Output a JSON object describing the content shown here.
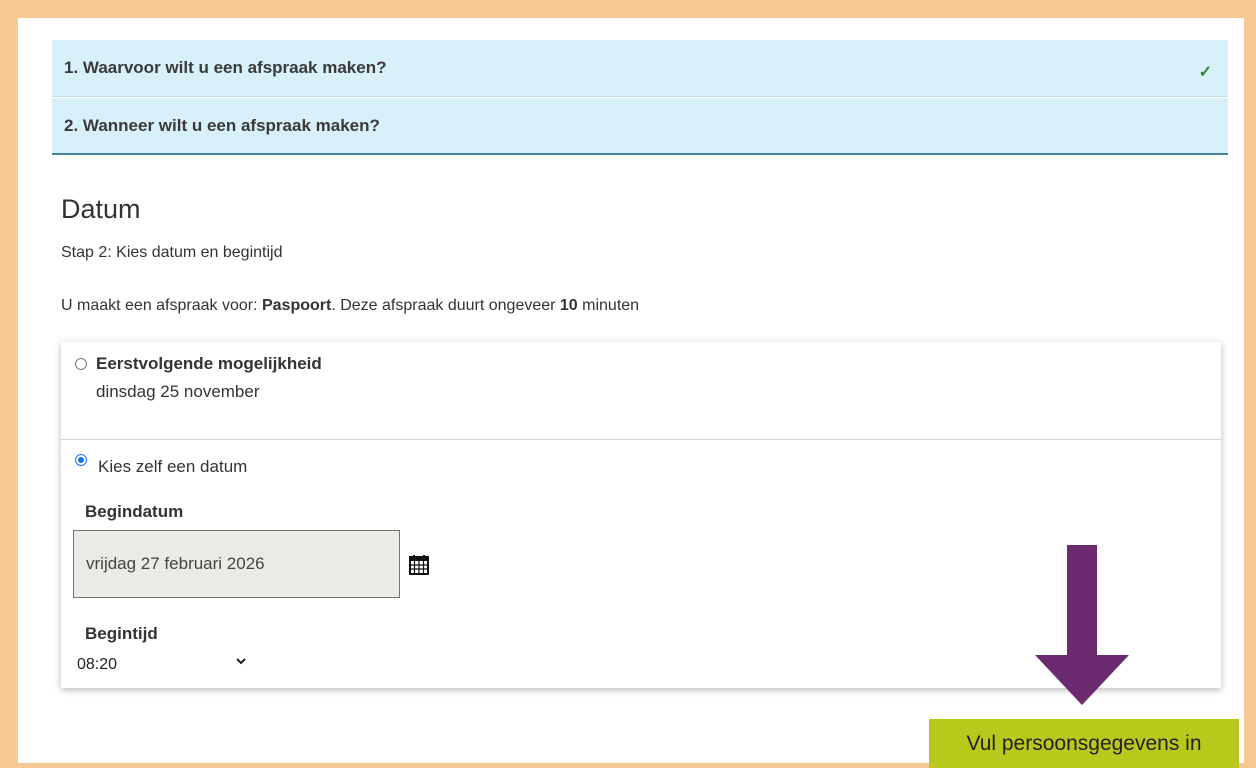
{
  "steps": [
    {
      "label": "1. Waarvoor wilt u een afspraak maken?",
      "status": "✓"
    },
    {
      "label": "2. Wanneer wilt u een afspraak maken?"
    }
  ],
  "section": {
    "title": "Datum",
    "subtitle": "Stap 2: Kies datum en begintijd",
    "info_prefix": "U maakt een afspraak voor: ",
    "product": "Paspoort",
    "info_mid": ". Deze afspraak duurt ongeveer ",
    "duration": "10",
    "info_suffix": " minuten"
  },
  "options": {
    "first": {
      "title": "Eerstvolgende mogelijkheid",
      "date": "dinsdag 25 november",
      "selected": false
    },
    "choose": {
      "label": "Kies zelf een datum",
      "selected": true
    }
  },
  "form": {
    "start_date_label": "Begindatum",
    "start_date_value": "vrijdag 27 februari 2026",
    "start_time_label": "Begintijd",
    "start_time_value": "08:20"
  },
  "cta": {
    "label": "Vul persoonsgegevens in"
  },
  "colors": {
    "border": "#f6c894",
    "step_bg": "#d8f0fa",
    "cta_bg": "#b9c91c",
    "arrow": "#6b2a6f",
    "radio_accent": "#1a73e8"
  },
  "icons": {
    "calendar": "calendar-icon",
    "check": "checkmark-icon",
    "chevron": "chevron-down-icon",
    "arrow": "down-arrow-icon"
  }
}
